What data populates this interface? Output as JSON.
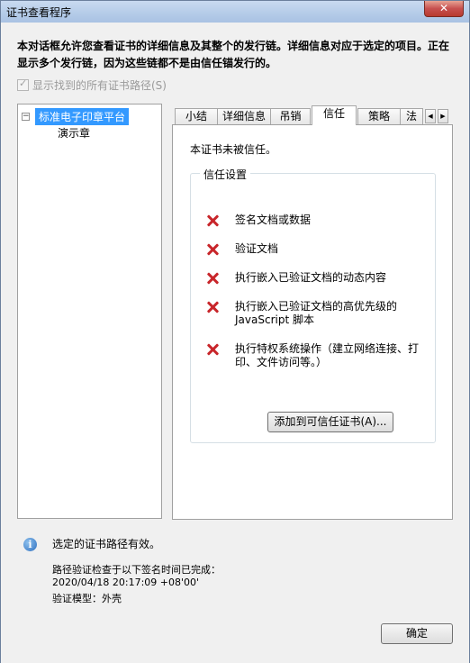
{
  "window": {
    "title": "证书查看程序",
    "close_glyph": "✕"
  },
  "intro_text": "本对话框允许您查看证书的详细信息及其整个的发行链。详细信息对应于选定的项目。正在显示多个发行链，因为这些链都不是由信任锚发行的。",
  "show_all_paths": {
    "label": "显示找到的所有证书路径(S)",
    "checked": true,
    "disabled": true
  },
  "tree": {
    "root": "标准电子印章平台",
    "child": "演示章",
    "expander_glyph": "−"
  },
  "tabs": [
    {
      "label": "小结"
    },
    {
      "label": "详细信息"
    },
    {
      "label": "吊销"
    },
    {
      "label": "信任",
      "active": true
    },
    {
      "label": "策略"
    },
    {
      "label": "法"
    }
  ],
  "tab_scroll": {
    "left": "◀",
    "right": "▶"
  },
  "trust_panel": {
    "status": "本证书未被信任。",
    "group_title": "信任设置",
    "items": [
      "签名文档或数据",
      "验证文档",
      "执行嵌入已验证文档的动态内容",
      "执行嵌入已验证文档的高优先级的JavaScript 脚本",
      "执行特权系统操作（建立网络连接、打印、文件访问等。）"
    ],
    "add_button": "添加到可信任证书(A)..."
  },
  "footer": {
    "status": "选定的证书路径有效。",
    "info_glyph": "i",
    "details": [
      "路径验证检查于以下签名时间已完成：",
      "2020/04/18 20:17:09 +08'00'",
      "验证模型：外壳"
    ],
    "ok_button": "确定"
  },
  "colors": {
    "selection": "#3399ff",
    "error_x": "#c8262b",
    "close_button": "#c75050"
  }
}
